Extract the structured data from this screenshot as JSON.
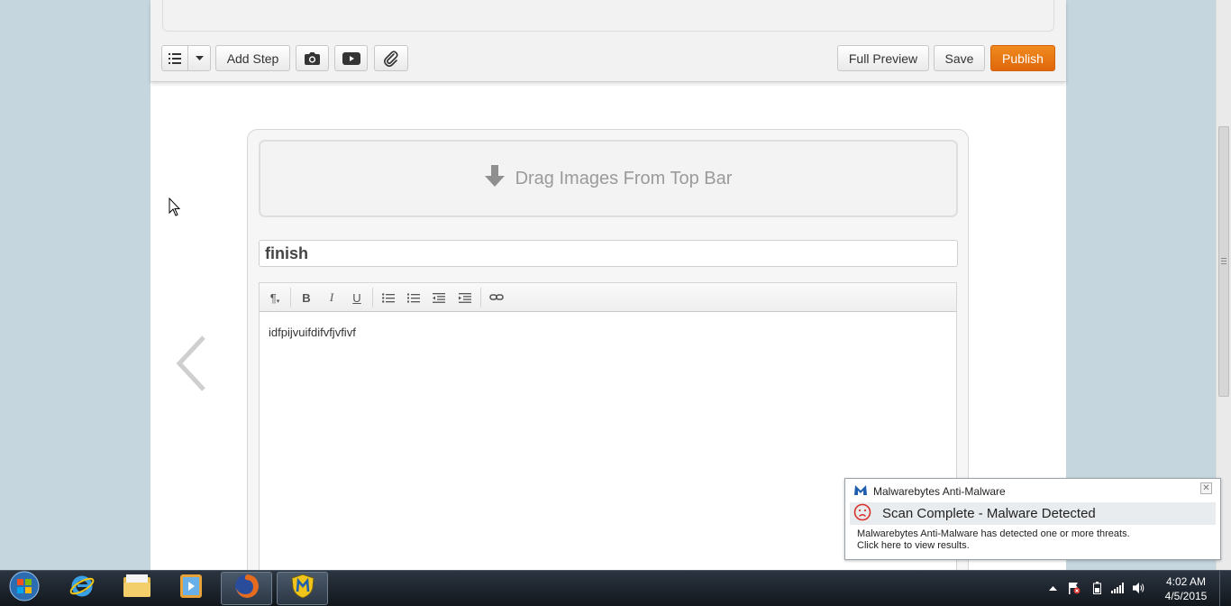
{
  "toolbar": {
    "add_step_label": "Add Step",
    "full_preview_label": "Full Preview",
    "save_label": "Save",
    "publish_label": "Publish",
    "icons": [
      "list-icon",
      "caret-down-icon",
      "camera-icon",
      "youtube-icon",
      "paperclip-icon"
    ]
  },
  "step": {
    "drag_images_label": "Drag Images From Top Bar",
    "title_value": "finish",
    "body_text": "idfpijvuifdifvfjvfivf"
  },
  "editor_toolbar": {
    "buttons": [
      "paragraph-icon",
      "bold-icon",
      "italic-icon",
      "underline-icon",
      "bullet-list-icon",
      "numbered-list-icon",
      "outdent-icon",
      "indent-icon",
      "link-icon"
    ]
  },
  "notification": {
    "app_name": "Malwarebytes Anti-Malware",
    "headline": "Scan Complete - Malware Detected",
    "message_line1": "Malwarebytes Anti-Malware has detected one or more threats.",
    "message_line2": "Click here to view results."
  },
  "taskbar": {
    "time": "4:02 AM",
    "date": "4/5/2015",
    "apps": [
      "start-orb",
      "internet-explorer",
      "file-explorer",
      "media-player",
      "firefox",
      "malwarebytes"
    ]
  },
  "colors": {
    "publish": "#e8760f",
    "desktop": "#c5d6df",
    "alert_red": "#d9302c"
  }
}
